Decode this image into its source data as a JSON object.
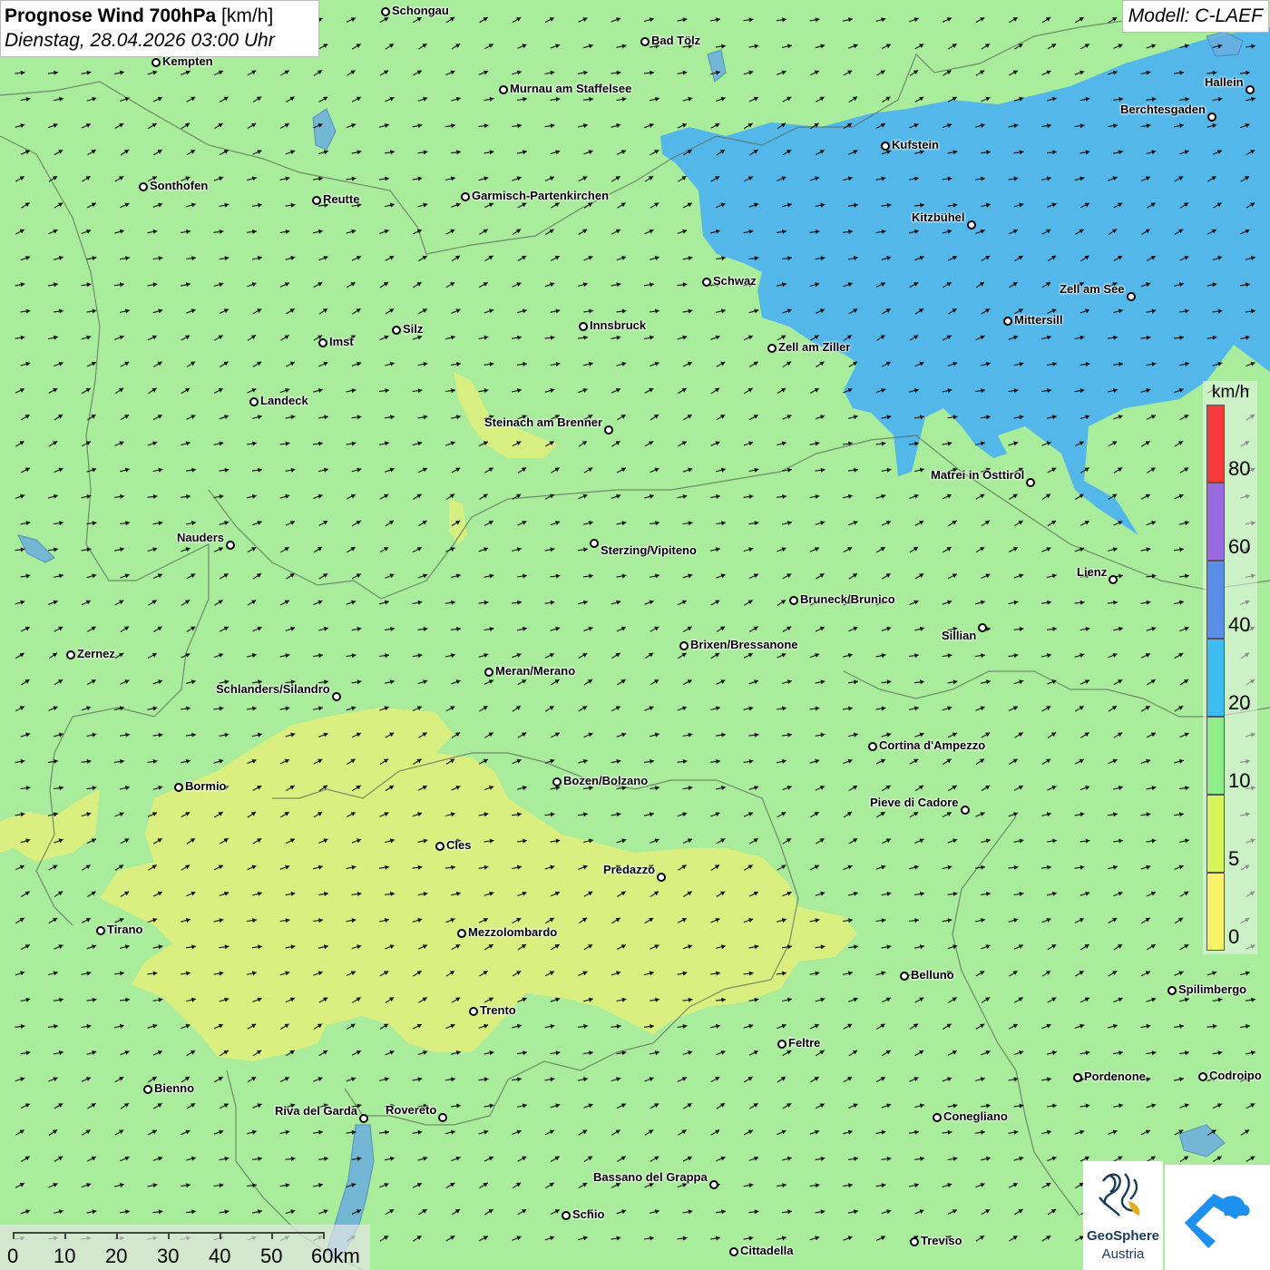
{
  "header": {
    "title_bold": "Prognose Wind 700hPa",
    "title_unit": "[km/h]",
    "datetime": "Dienstag, 28.04.2026 03:00 Uhr",
    "model": "Modell: C-LAEF"
  },
  "colors": {
    "background": "#a9ec9b",
    "calm_yellow": "#dcef7e",
    "wind_blue": "#4cb2f0",
    "arrow": "#111111"
  },
  "legend": {
    "unit": "km/h",
    "ticks": [
      "0",
      "5",
      "10",
      "20",
      "40",
      "60",
      "80"
    ],
    "bands": [
      {
        "from": 0,
        "to": 5,
        "color": "#f8f26a"
      },
      {
        "from": 5,
        "to": 10,
        "color": "#d6f55a"
      },
      {
        "from": 10,
        "to": 20,
        "color": "#8fee8a"
      },
      {
        "from": 20,
        "to": 40,
        "color": "#3dbcef"
      },
      {
        "from": 40,
        "to": 60,
        "color": "#5a8ee8"
      },
      {
        "from": 60,
        "to": 80,
        "color": "#9a6ae0"
      },
      {
        "from": 80,
        "to": 100,
        "color": "#f43a3a"
      }
    ]
  },
  "scale_bar": {
    "labels": [
      "0",
      "10",
      "20",
      "30",
      "40",
      "50",
      "60km"
    ]
  },
  "cities": [
    {
      "name": "Schongau"
    },
    {
      "name": "Bad Tölz"
    },
    {
      "name": "Kempten"
    },
    {
      "name": "Murnau am Staffelsee"
    },
    {
      "name": "Hallein"
    },
    {
      "name": "Berchtesgaden"
    },
    {
      "name": "Kufstein"
    },
    {
      "name": "Sonthofen"
    },
    {
      "name": "Reutte"
    },
    {
      "name": "Garmisch-Partenkirchen"
    },
    {
      "name": "Kitzbühel"
    },
    {
      "name": "Schwaz"
    },
    {
      "name": "Zell am See"
    },
    {
      "name": "Mittersill"
    },
    {
      "name": "Innsbruck"
    },
    {
      "name": "Silz"
    },
    {
      "name": "Imst"
    },
    {
      "name": "Zell am Ziller"
    },
    {
      "name": "Landeck"
    },
    {
      "name": "Steinach am Brenner"
    },
    {
      "name": "Matrei in Osttirol"
    },
    {
      "name": "Nauders"
    },
    {
      "name": "Sterzing/Vipiteno"
    },
    {
      "name": "Lienz"
    },
    {
      "name": "Bruneck/Brunico"
    },
    {
      "name": "Sillian"
    },
    {
      "name": "Zernez"
    },
    {
      "name": "Brixen/Bressanone"
    },
    {
      "name": "Meran/Merano"
    },
    {
      "name": "Schlanders/Silandro"
    },
    {
      "name": "Cortina d'Ampezzo"
    },
    {
      "name": "Bozen/Bolzano"
    },
    {
      "name": "Bormio"
    },
    {
      "name": "Pieve di Cadore"
    },
    {
      "name": "Cles"
    },
    {
      "name": "Predazzo"
    },
    {
      "name": "Tirano"
    },
    {
      "name": "Mezzolombardo"
    },
    {
      "name": "Belluno"
    },
    {
      "name": "Spilimbergo"
    },
    {
      "name": "Trento"
    },
    {
      "name": "Feltre"
    },
    {
      "name": "Pordenone"
    },
    {
      "name": "Codroipo"
    },
    {
      "name": "Bienno"
    },
    {
      "name": "Riva del Garda"
    },
    {
      "name": "Rovereto"
    },
    {
      "name": "Conegliano"
    },
    {
      "name": "Bassano del Grappa"
    },
    {
      "name": "Schio"
    },
    {
      "name": "Treviso"
    },
    {
      "name": "Cittadella"
    }
  ],
  "logos": {
    "geosphere_name": "GeoSphere",
    "geosphere_sub": "Austria"
  }
}
